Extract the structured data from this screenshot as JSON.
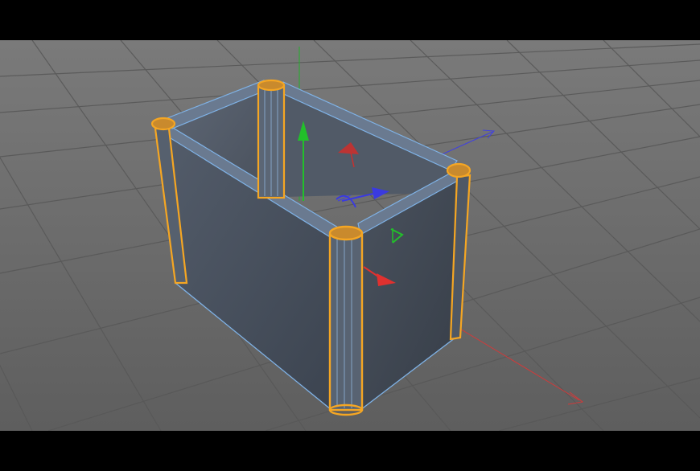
{
  "viewport": {
    "background_color": "#6e6e6e",
    "grid_color": "#5c5c5c",
    "letterbox_color": "#000000"
  },
  "scene_object": {
    "selection_outline_color": "#f5a623",
    "edge_highlight_color": "#7fb2e6",
    "surface_color": "#4b5563"
  },
  "axes": {
    "x_axis_color": "#e0312f",
    "y_axis_color": "#22c02a",
    "z_axis_color": "#3a3ae0"
  },
  "icons": [
    "viewport-grid",
    "move-gizmo",
    "rotation-handle",
    "scale-handle"
  ]
}
